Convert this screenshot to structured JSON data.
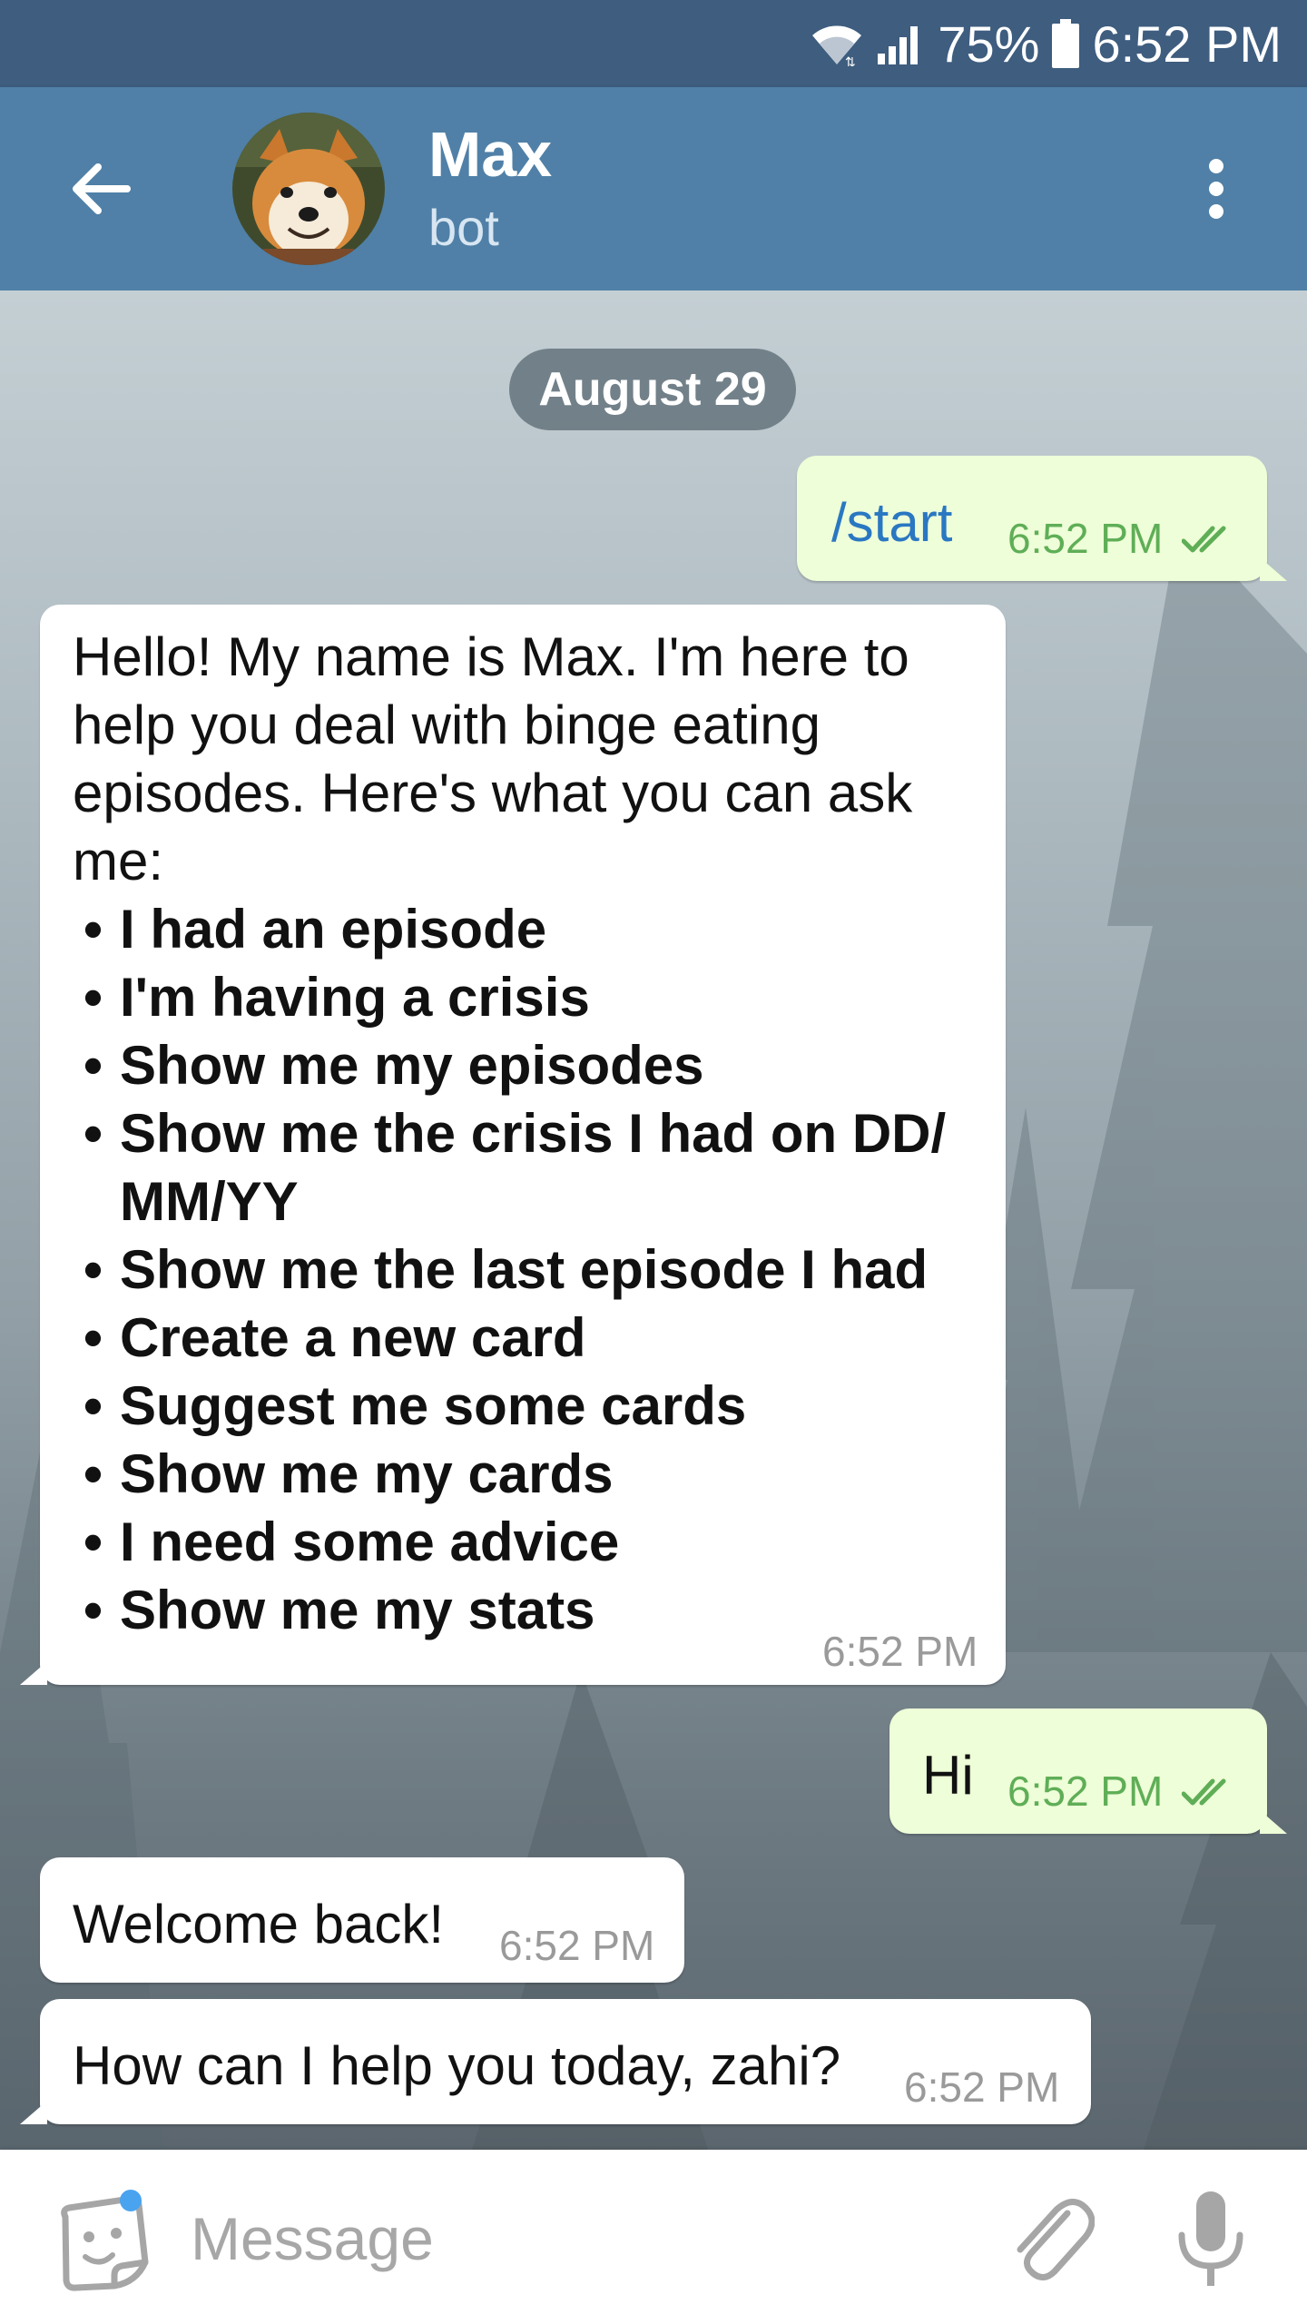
{
  "status": {
    "battery": "75%",
    "time": "6:52 PM"
  },
  "header": {
    "title": "Max",
    "subtitle": "bot"
  },
  "chat": {
    "date": "August 29",
    "messages": [
      {
        "from": "me",
        "command": "/start",
        "time": "6:52 PM"
      },
      {
        "from": "bot",
        "intro": "Hello! My name is Max. I'm here to help you deal with binge eating episodes. Here's what you can ask me:",
        "items": [
          "I had an episode",
          "I'm having a crisis",
          "Show me my episodes",
          "Show me the crisis I had on DD/ MM/YY",
          "Show me the last episode I had",
          "Create a new card",
          "Suggest me some cards",
          "Show me my cards",
          "I need some advice",
          "Show me my stats"
        ],
        "time": "6:52 PM"
      },
      {
        "from": "me",
        "text": "Hi",
        "time": "6:52 PM"
      },
      {
        "from": "bot",
        "text": "Welcome back!",
        "time": "6:52 PM"
      },
      {
        "from": "bot",
        "text": "How can I help you today, zahi?",
        "time": "6:52 PM"
      }
    ]
  },
  "input": {
    "placeholder": "Message"
  },
  "colors": {
    "status_bar": "#3e5d7f",
    "header": "#5080a7",
    "outgoing_bubble": "#eefed8",
    "incoming_bubble": "#ffffff",
    "link": "#2a78c2",
    "read_ticks": "#5fae57"
  },
  "icons": {
    "back": "arrow-left-icon",
    "more": "more-vertical-icon",
    "sticker": "sticker-icon",
    "attach": "paperclip-icon",
    "mic": "microphone-icon",
    "wifi": "wifi-icon",
    "signal": "signal-icon",
    "battery": "battery-icon",
    "read": "double-check-icon"
  }
}
